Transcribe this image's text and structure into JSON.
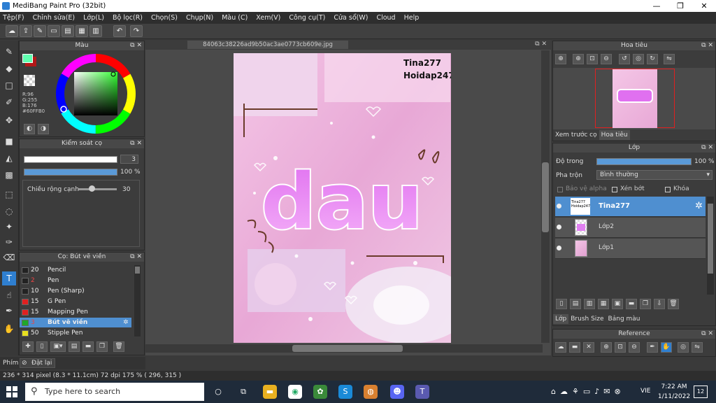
{
  "window": {
    "title": "MediBang Paint Pro (32bit)",
    "controls": [
      "—",
      "❐",
      "✕"
    ]
  },
  "menu": [
    "Tệp(F)",
    "Chỉnh sửa(E)",
    "Lớp(L)",
    "Bộ lọc(R)",
    "Chọn(S)",
    "Chụp(N)",
    "Màu (C)",
    "Xem(V)",
    "Công cụ(T)",
    "Cửa sổ(W)",
    "Cloud",
    "Help"
  ],
  "color_panel": {
    "title": "Màu",
    "readout": [
      "R:96",
      "G:255",
      "B:176",
      "#60FFB0"
    ],
    "foreground": "#60FFB0",
    "background": "#b01818"
  },
  "brush_control": {
    "title": "Kiểm soát cọ",
    "size": "3",
    "opacity": "100 %",
    "edge_label": "Chiều rộng cạnh",
    "edge_value": "30"
  },
  "brush_list": {
    "title": "Cọ: Bút vẽ viền",
    "items": [
      {
        "num": "20",
        "name": "Pencil",
        "color": "#222222"
      },
      {
        "num": "2",
        "name": "Pen",
        "color": "#222222"
      },
      {
        "num": "10",
        "name": "Pen (Sharp)",
        "color": "#222222"
      },
      {
        "num": "15",
        "name": "G Pen",
        "color": "#e02020"
      },
      {
        "num": "15",
        "name": "Mapping Pen",
        "color": "#e02020"
      },
      {
        "num": "3",
        "name": "Bút vẽ viền",
        "color": "#1fa82a"
      },
      {
        "num": "50",
        "name": "Stipple Pen",
        "color": "#e8e020"
      }
    ]
  },
  "document": {
    "tab": "84063c38226ad9b50ac3ae0773cb609e.jpg"
  },
  "artwork": {
    "watermark_line1": "Tina277",
    "watermark_line2": "Hoidap247",
    "title_text": "dau"
  },
  "navigator": {
    "title": "Hoa tiêu",
    "tabs": [
      "Xem trước cọ",
      "Hoa tiêu"
    ]
  },
  "layers": {
    "title": "Lớp",
    "opacity_label": "Độ trong",
    "opacity_value": "100 %",
    "blend_label": "Pha trộn",
    "blend_value": "Bình thường",
    "options": [
      "Bảo vệ alpha",
      "Xén bớt",
      "Khóa"
    ],
    "items": [
      {
        "name": "Tina277",
        "thumb": "Tina277 Hoidap247"
      },
      {
        "name": "Lớp2"
      },
      {
        "name": "Lớp1"
      }
    ],
    "tabs": [
      "Lớp",
      "Brush Size",
      "Bảng màu"
    ]
  },
  "reference": {
    "title": "Reference"
  },
  "bottom_left": {
    "tab": "Phím",
    "reset": "Đặt lại"
  },
  "status": {
    "text": "236 * 314 pixel   (8.3 * 11.1cm)  72 dpi   175 %   ( 296, 315 )"
  },
  "taskbar": {
    "search_placeholder": "Type here to search",
    "lang": "VIE",
    "time": "7:22 AM",
    "date": "1/11/2022",
    "notifications": "12"
  },
  "colors": {
    "accent": "#2f7fd0",
    "selected_layer": "#4f8fd0"
  }
}
